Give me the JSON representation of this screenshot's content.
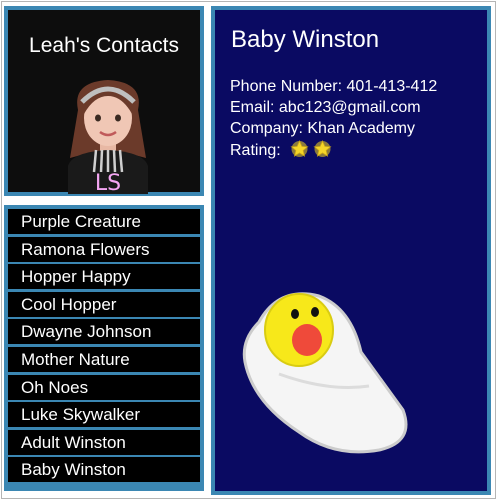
{
  "app": {
    "title": "Leah's Contacts",
    "avatar_initials": "LS"
  },
  "contacts": [
    "Purple Creature",
    "Ramona Flowers",
    "Hopper Happy",
    "Cool Hopper",
    "Dwayne Johnson",
    "Mother Nature",
    "Oh Noes",
    "Luke Skywalker",
    "Adult Winston",
    "Baby Winston"
  ],
  "selected_contact": {
    "name": "Baby Winston",
    "phone_line": "Phone Number: 401-413-412",
    "email_line": "Email: abc123@gmail.com",
    "company_line": "Company: Khan Academy",
    "rating_label": "Rating:",
    "rating_stars": 2
  },
  "colors": {
    "accent_border": "#3b87b3",
    "detail_background": "#0a0a62",
    "list_background": "#000000",
    "avatar_initials": "#f4a6f2"
  },
  "icons": {
    "profile_avatar": "girl-avatar-icon",
    "rating_star": "star-icon",
    "contact_image": "baby-winston-icon"
  }
}
